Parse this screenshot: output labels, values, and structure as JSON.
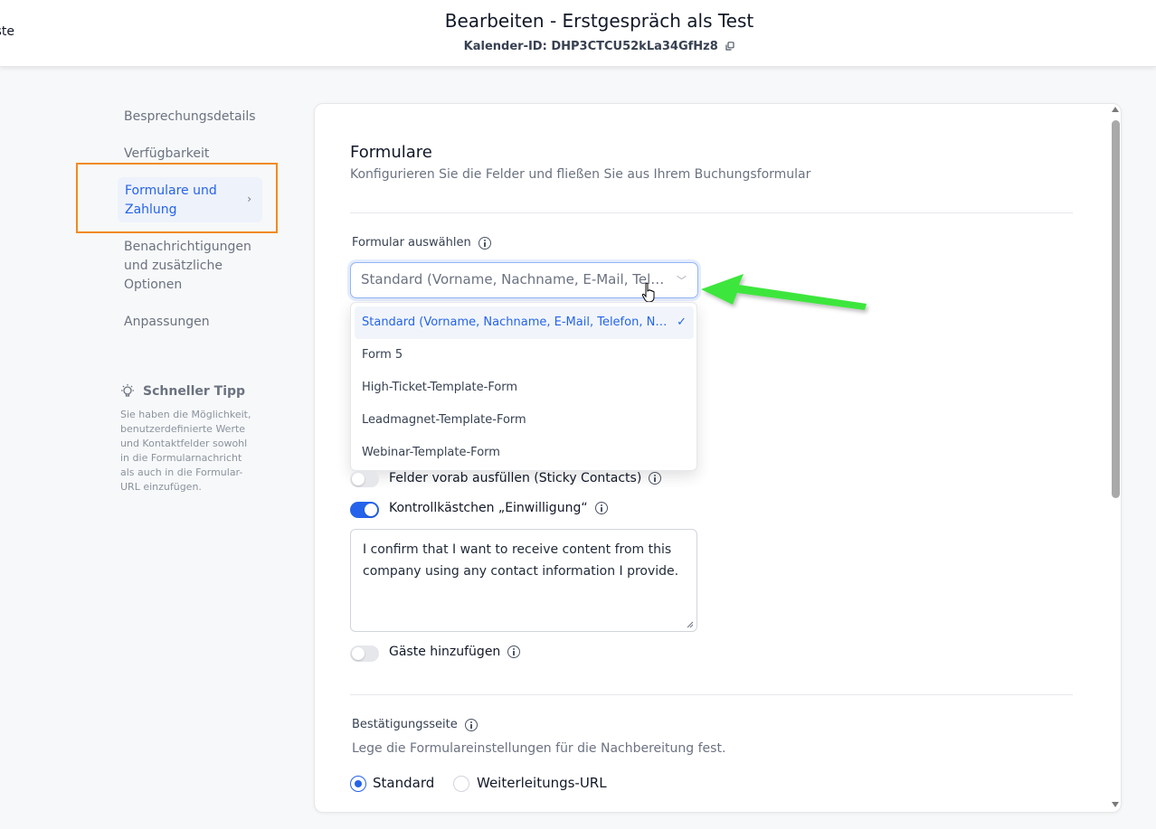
{
  "header": {
    "back_label": "ste",
    "title": "Bearbeiten - Erstgespräch als Test",
    "calendar_id": "Kalender-ID: DHP3CTCU52kLa34GfHz8"
  },
  "sidebar": {
    "items": [
      {
        "label": "Besprechungsdetails"
      },
      {
        "label": "Verfügbarkeit"
      },
      {
        "label_line1": "Formulare und",
        "label_line2": "Zahlung"
      },
      {
        "label_line1": "Benachrichtigungen",
        "label_line2": "und zusätzliche",
        "label_line3": "Optionen"
      },
      {
        "label": "Anpassungen"
      }
    ],
    "active_index": 2,
    "tip": {
      "title": "Schneller Tipp",
      "lines": [
        "Sie haben die Möglichkeit,",
        "benutzerdefinierte Werte",
        "und Kontaktfelder sowohl",
        "in die Formularnachricht",
        "als auch in die Formular-",
        "URL einzufügen."
      ]
    }
  },
  "forms": {
    "title": "Formulare",
    "description": "Konfigurieren Sie die Felder und fließen Sie aus Ihrem Buchungsformular",
    "select_label": "Formular auswählen",
    "selected_value": "Standard (Vorname, Nachname, E-Mail, Telefon, Notizen)",
    "options": [
      "Standard (Vorname, Nachname, E-Mail, Telefon, Notizen)",
      "Form 5",
      "High-Ticket-Template-Form",
      "Leadmagnet-Template-Form",
      "Webinar-Template-Form"
    ],
    "selected_index": 0,
    "sticky_contacts_label": "Felder vorab ausfüllen (Sticky Contacts)",
    "sticky_contacts_on": false,
    "consent_label": "Kontrollkästchen „Einwilligung“",
    "consent_on": true,
    "consent_text": "I confirm that I want to receive content from this company using any contact information I provide.",
    "guests_label": "Gäste hinzufügen",
    "guests_on": false
  },
  "confirmation": {
    "title": "Bestätigungsseite",
    "description": "Lege die Formulareinstellungen für die Nachbereitung fest.",
    "options": [
      "Standard",
      "Weiterleitungs-URL"
    ],
    "selected_index": 0
  },
  "colors": {
    "accent": "#2563eb",
    "highlight_box": "#f28a1e",
    "annotation_arrow": "#3ee63e"
  }
}
